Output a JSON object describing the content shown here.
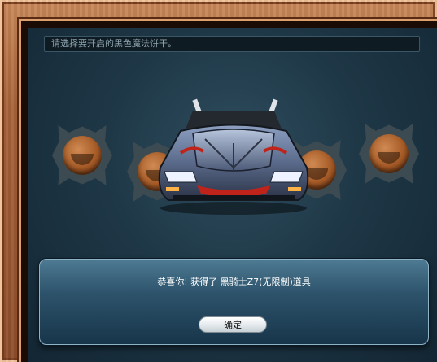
{
  "prompt": {
    "text": "请选择要开启的黑色魔法饼干。"
  },
  "cookies": [
    {
      "name": "magic-cookie"
    },
    {
      "name": "magic-cookie"
    },
    {
      "name": "magic-cookie"
    },
    {
      "name": "magic-cookie"
    }
  ],
  "reward": {
    "item_icon": "car-icon",
    "message": "恭喜你! 获得了 黑骑士Z7(无限制)道具"
  },
  "dialog": {
    "ok_label": "确定"
  },
  "colors": {
    "frame_wood": "#a8633a",
    "stage_bg": "#1e3746",
    "dialog_bg": "#2d536b",
    "car_trim": "#c0231a"
  }
}
